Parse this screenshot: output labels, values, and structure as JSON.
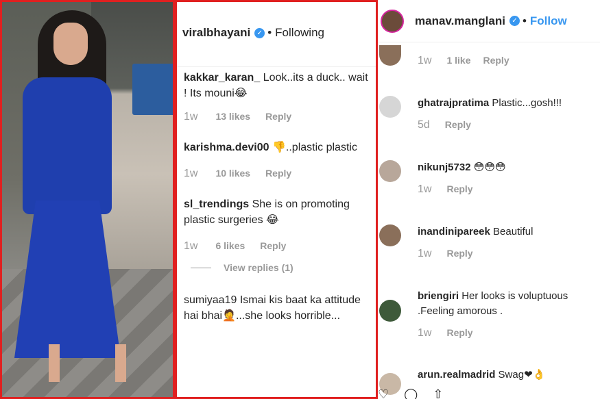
{
  "middle": {
    "header": {
      "username": "viralbhayani",
      "separator": "•",
      "following_label": "Following"
    },
    "comments": [
      {
        "username": "kakkar_karan_",
        "text": "Look..its a duck.. wait ! Its mouni😂",
        "time": "1w",
        "likes": "13 likes",
        "reply_label": "Reply"
      },
      {
        "username": "karishma.devi00",
        "text": "👎..plastic plastic",
        "time": "1w",
        "likes": "10 likes",
        "reply_label": "Reply"
      },
      {
        "username": "sl_trendings",
        "text": "She is on promoting plastic surgeries 😂",
        "time": "1w",
        "likes": "6 likes",
        "reply_label": "Reply"
      },
      {
        "username": "sumiyaa19",
        "text": "Ismai kis baat ka attitude hai bhai🤦...she looks horrible...",
        "time": "",
        "likes": "",
        "reply_label": ""
      }
    ],
    "view_replies_label": "View replies (1)"
  },
  "right": {
    "header": {
      "username": "manav.manglani",
      "separator": "•",
      "follow_label": "Follow"
    },
    "top_meta": {
      "time": "1w",
      "likes": "1 like",
      "reply_label": "Reply"
    },
    "comments": [
      {
        "username": "ghatrajpratima",
        "text": "Plastic...gosh!!!",
        "time": "5d",
        "likes": "",
        "reply_label": "Reply",
        "avatar_color": "#d6d6d6"
      },
      {
        "username": "nikunj5732",
        "text": "😳😳😳",
        "time": "1w",
        "likes": "",
        "reply_label": "Reply",
        "avatar_color": "#b8a79a"
      },
      {
        "username": "inandinipareek",
        "text": "Beautiful",
        "time": "1w",
        "likes": "",
        "reply_label": "Reply",
        "avatar_color": "#8a6f5a"
      },
      {
        "username": "briengiri",
        "text": "Her looks is voluptuous .Feeling amorous .",
        "time": "1w",
        "likes": "",
        "reply_label": "Reply",
        "avatar_color": "#3e5a3a"
      },
      {
        "username": "arun.realmadrid",
        "text": "Swag❤👌",
        "time": "",
        "likes": "",
        "reply_label": "",
        "avatar_color": "#c9b8a6"
      }
    ]
  },
  "colors": {
    "frame_red": "#e02020",
    "instagram_blue": "#3897f0",
    "meta_gray": "#999999",
    "dress_blue": "#2140b4"
  }
}
